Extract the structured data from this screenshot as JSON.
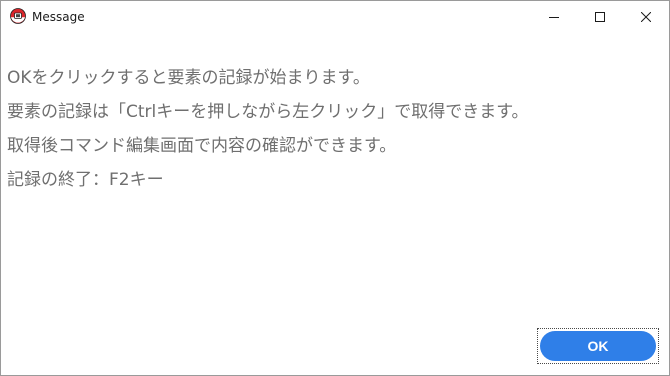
{
  "window": {
    "title": "Message",
    "app_icon": "record-app-icon",
    "controls": {
      "minimize_icon": "minimize-icon",
      "maximize_icon": "maximize-icon",
      "close_icon": "close-icon"
    }
  },
  "message": {
    "lines": [
      "OKをクリックすると要素の記録が始まります。",
      "要素の記録は「Ctrlキーを押しながら左クリック」で取得できます。",
      "取得後コマンド編集画面で内容の確認ができます。",
      "記録の終了：F2キー"
    ]
  },
  "buttons": {
    "ok_label": "OK"
  },
  "colors": {
    "accent": "#2f7fe8",
    "text": "#6f6f6f",
    "icon_red": "#d9262c"
  }
}
